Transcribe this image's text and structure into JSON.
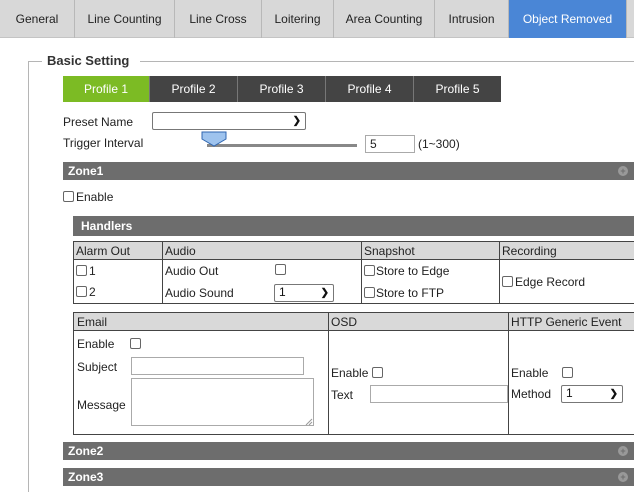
{
  "top_tabs": [
    {
      "label": "General",
      "active": false
    },
    {
      "label": "Line Counting",
      "active": false
    },
    {
      "label": "Line Cross",
      "active": false
    },
    {
      "label": "Loitering",
      "active": false
    },
    {
      "label": "Area Counting",
      "active": false
    },
    {
      "label": "Intrusion",
      "active": false
    },
    {
      "label": "Object Removed",
      "active": true
    }
  ],
  "section": {
    "legend": "Basic Setting"
  },
  "profile_tabs": [
    {
      "label": "Profile 1",
      "active": true
    },
    {
      "label": "Profile 2",
      "active": false
    },
    {
      "label": "Profile 3",
      "active": false
    },
    {
      "label": "Profile 4",
      "active": false
    },
    {
      "label": "Profile 5",
      "active": false
    }
  ],
  "preset": {
    "label": "Preset Name",
    "value": ""
  },
  "trigger": {
    "label": "Trigger Interval",
    "value": "5",
    "range": "(1~300)",
    "slider_fraction": 0.013
  },
  "zone1": {
    "title": "Zone1",
    "enable_label": "Enable",
    "enabled": false,
    "handlers": {
      "title": "Handlers",
      "alarm_out": {
        "header": "Alarm Out",
        "items": [
          "1",
          "2"
        ]
      },
      "audio": {
        "header": "Audio",
        "out_label": "Audio Out",
        "sound_label": "Audio Sound",
        "sound_value": "1"
      },
      "snapshot": {
        "header": "Snapshot",
        "edge_label": "Store to Edge",
        "ftp_label": "Store to FTP"
      },
      "recording": {
        "header": "Recording",
        "edge_label": "Edge Record"
      }
    },
    "email": {
      "header": "Email",
      "enable_label": "Enable",
      "subject_label": "Subject",
      "message_label": "Message",
      "subject_value": "",
      "message_value": ""
    },
    "osd": {
      "header": "OSD",
      "enable_label": "Enable",
      "text_label": "Text",
      "text_value": ""
    },
    "http": {
      "header": "HTTP Generic Event",
      "enable_label": "Enable",
      "method_label": "Method",
      "method_value": "1"
    }
  },
  "zones_collapsed": [
    {
      "title": "Zone2"
    },
    {
      "title": "Zone3"
    }
  ],
  "colors": {
    "active_tab": "#4a86d6",
    "profile_active": "#7cbb24",
    "profile_inactive": "#444444",
    "zone_bar": "#6d6d6d"
  }
}
